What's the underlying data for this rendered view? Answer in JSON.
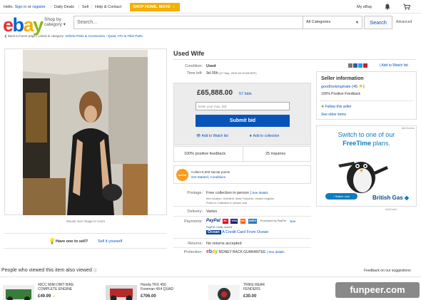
{
  "topbar": {
    "hello": "Hello.",
    "sign_in": "Sign in",
    "or": "or",
    "register": "register",
    "links": [
      "Daily Deals",
      "Sell",
      "Help & Contact"
    ],
    "promo": "SHOP HOME. MOVE",
    "my_ebay": "My eBay"
  },
  "header": {
    "logo": [
      "e",
      "b",
      "a",
      "y"
    ],
    "shop_by": "Shop by",
    "category": "category",
    "search_placeholder": "Search...",
    "category_select": "All Categories",
    "search_button": "Search",
    "advanced": "Advanced"
  },
  "breadcrumb": {
    "back": "Back to home page",
    "listed_in": "Listed in category:",
    "path": [
      "Vehicle Parts & Accessories",
      "Quad, ATV & Trike Parts"
    ]
  },
  "gallery": {
    "hint": "Mouse over image to zoom"
  },
  "sell_prompt": {
    "question": "Have one to sell?",
    "link": "Sell it yourself"
  },
  "item": {
    "title": "Used Wife",
    "watch_link": "Add to Watch list",
    "condition_label": "Condition:",
    "condition": "Used",
    "time_left_label": "Time left:",
    "time_left": "9d 05h",
    "end_time": "(17 Sep, 2019  22:19:03 BST)",
    "price": "£65,888.00",
    "bids": "57 bids",
    "max_bid_placeholder": "Enter your max. bid",
    "submit_bid": "Submit bid",
    "add_watch": "Add to Watch list",
    "add_collection": "Add to collection",
    "positive_feedback": "100% positive feedback",
    "inquiries": "25 inquiries"
  },
  "nectar": {
    "badge": "nectar",
    "collect": "Collect 5,000 Nectar points",
    "links": "Get Started | Conditions"
  },
  "details": {
    "postage_label": "Postage:",
    "postage": "Free collection in person",
    "see_details": "See details",
    "item_location": "Item location:  Holmfirth, West Yorkshire, United Kingdom",
    "posts_to": "Posts to:  Collection in person only",
    "delivery_label": "Delivery:",
    "delivery": "Varies",
    "payments_label": "Payments:",
    "paypal": "PayPal",
    "cards": [
      "MC",
      "VISA",
      "MC",
      "AMEX"
    ],
    "processed_by": "Processed by PayPal",
    "see": "See",
    "paypal_credit_line": "PayPal Credit. Advert",
    "credit_link": "A Credit Card From Ocean",
    "returns_label": "Returns:",
    "returns": "No returns accepted",
    "protection_label": "Protection:",
    "mbg": "MONEY BACK GUARANTEE",
    "mbg_details": "See details"
  },
  "seller": {
    "heading": "Seller information",
    "name": "goodlookingmale",
    "score": "45",
    "positive": "100% Positive Feedback",
    "follow": "Follow this seller",
    "other_items": "See other items"
  },
  "ad": {
    "adchoices": "AdChoices",
    "line1": "Switch to one of our",
    "line2a": "FreeTime",
    "line2b": "plans.",
    "cta": "Switch now",
    "brand": "British Gas",
    "footer": "AdChoice",
    "colors": {
      "blue": "#0b7dbf",
      "brand": "#0b4a8c"
    }
  },
  "also_viewed": {
    "title": "People who viewed this item also viewed",
    "feedback": "Feedback on our suggestions",
    "items": [
      {
        "title_1": "49CC MINI DIRT BIKE",
        "title_2": "COMPLETE ENGINE",
        "price": "£49.99"
      },
      {
        "title_1": "Honda TRX 450",
        "title_2": "Foreman 4X4 QUAD",
        "price": "£706.00"
      },
      {
        "title_1": "TRIKE REAR",
        "title_2": "FENDERS",
        "price": "£30.00"
      }
    ]
  },
  "watermark": "funpeer.com",
  "colors": {
    "ebay_red": "#e53238",
    "ebay_blue": "#0064d2",
    "ebay_yellow": "#f5af02",
    "ebay_green": "#86b817",
    "link": "#0654ba",
    "bid_button": "#0654ba"
  }
}
